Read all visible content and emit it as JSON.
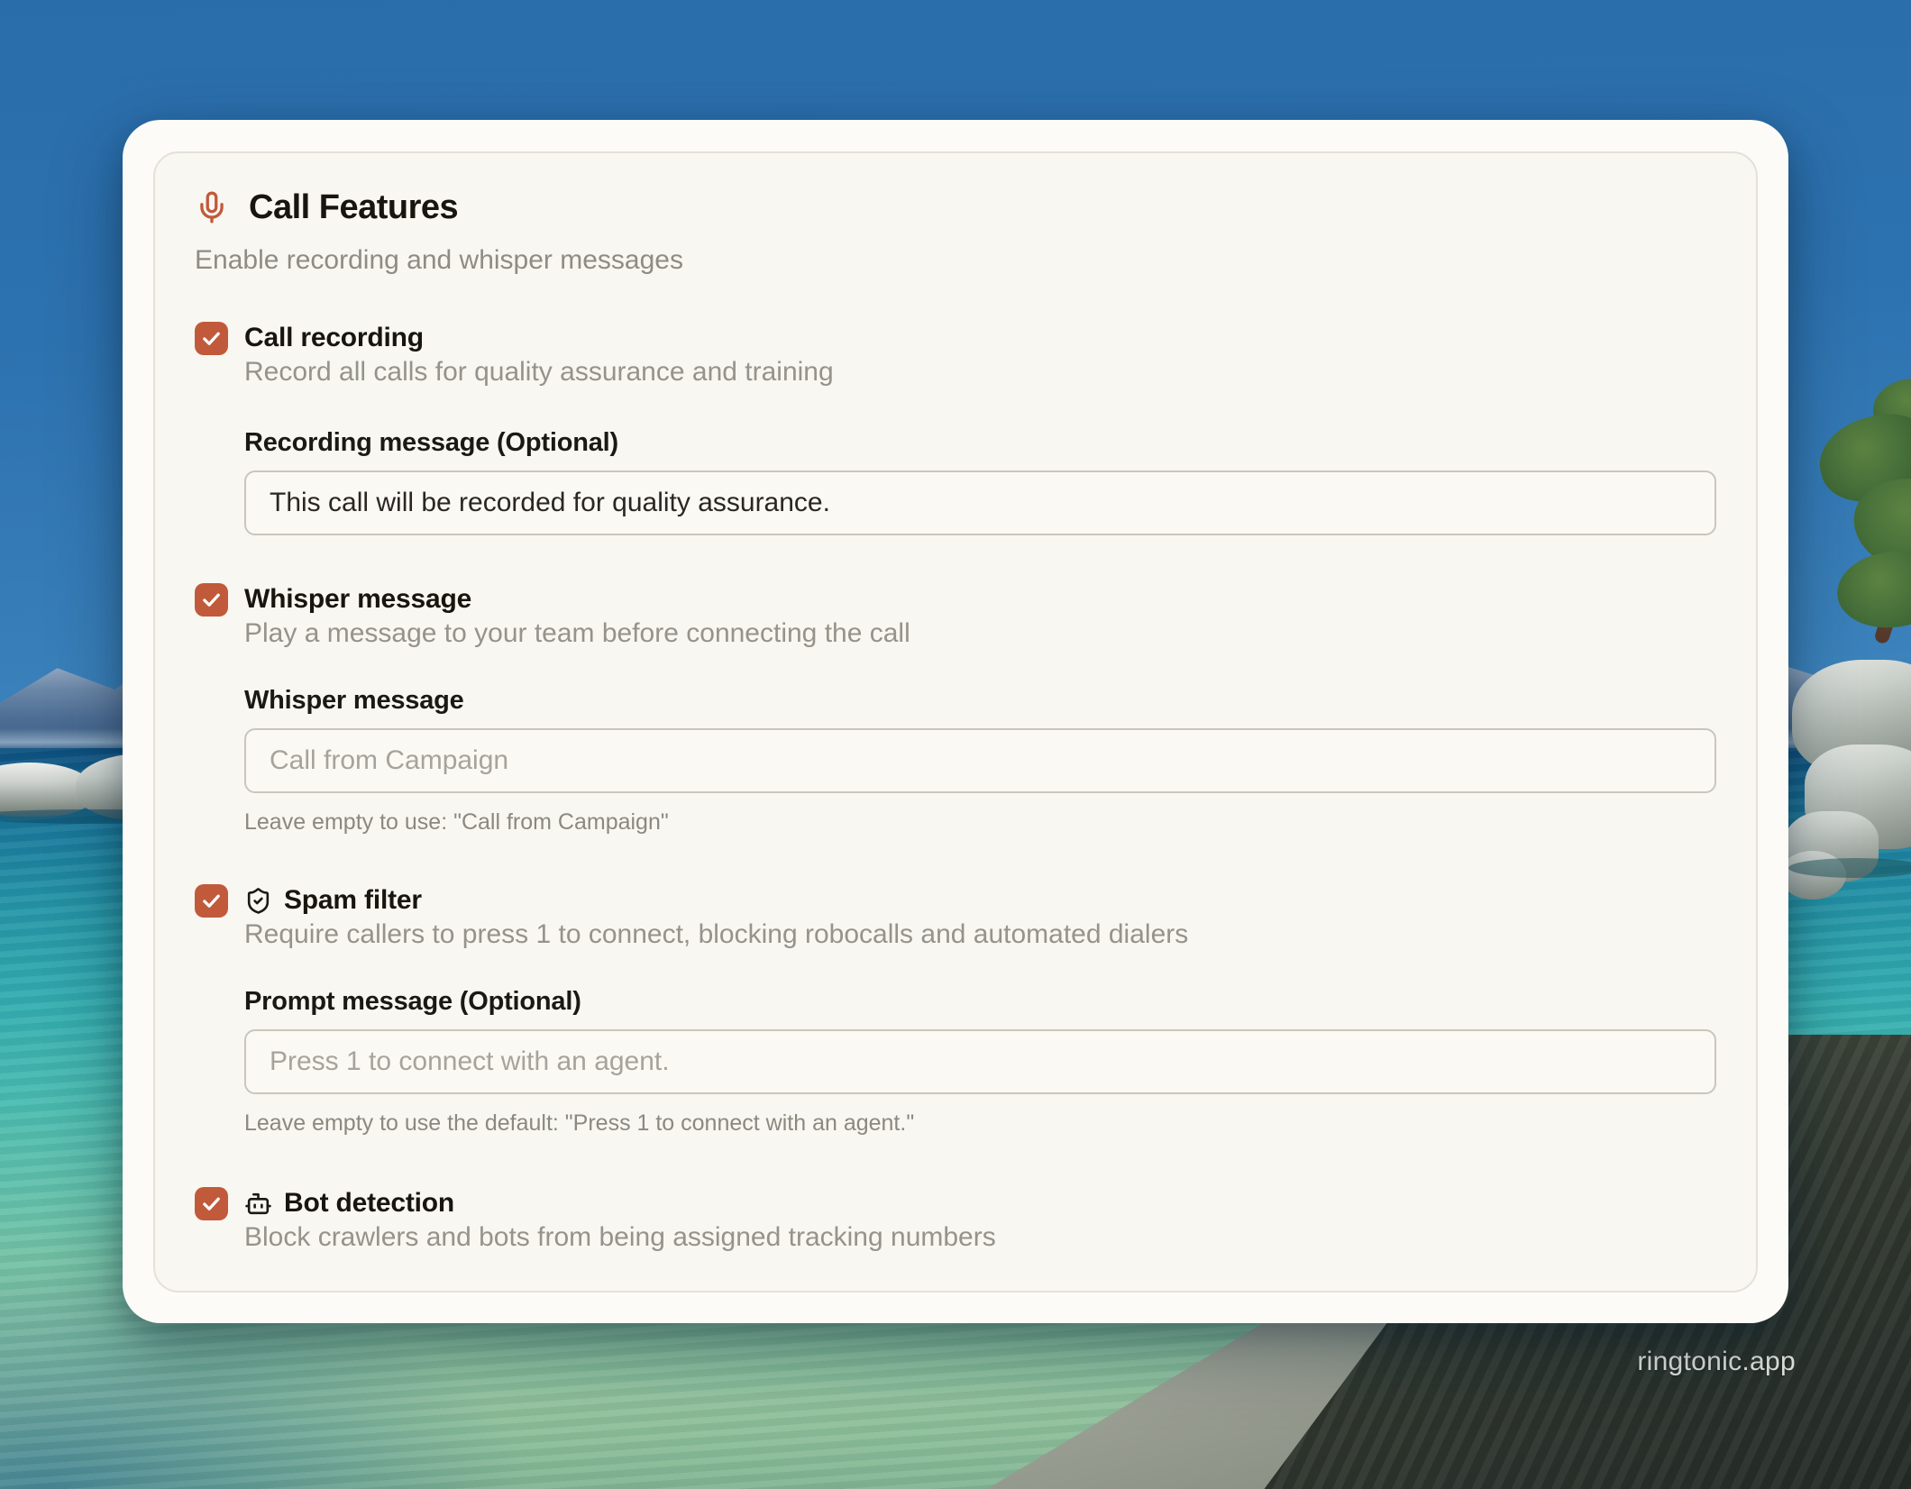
{
  "watermark": "ringtonic.app",
  "panel": {
    "title": "Call Features",
    "subtitle": "Enable recording and whisper messages"
  },
  "features": [
    {
      "label": "Call recording",
      "checked": true,
      "description": "Record all calls for quality assurance and training",
      "field": {
        "label": "Recording message (Optional)",
        "value": "This call will be recorded for quality assurance."
      }
    },
    {
      "label": "Whisper message",
      "checked": true,
      "description": "Play a message to your team before connecting the call",
      "field": {
        "label": "Whisper message",
        "placeholder": "Call from Campaign",
        "helper": "Leave empty to use: \"Call from Campaign\""
      }
    },
    {
      "label": "Spam filter",
      "icon": "shield-check-icon",
      "checked": true,
      "description": "Require callers to press 1 to connect, blocking robocalls and automated dialers",
      "field": {
        "label": "Prompt message (Optional)",
        "placeholder": "Press 1 to connect with an agent.",
        "helper": "Leave empty to use the default: \"Press 1 to connect with an agent.\""
      }
    },
    {
      "label": "Bot detection",
      "icon": "bot-icon",
      "checked": true,
      "description": "Block crawlers and bots from being assigned tracking numbers"
    }
  ],
  "colors": {
    "accent": "#c15a3b",
    "card_background": "#f8f7f1",
    "card_border": "#e4e1d7",
    "heading_text": "#18150f",
    "muted_text": "#8e8c83",
    "input_border": "#c9c6bb",
    "sky_blue": "#2d72b0",
    "water_teal": "#33adb0"
  }
}
